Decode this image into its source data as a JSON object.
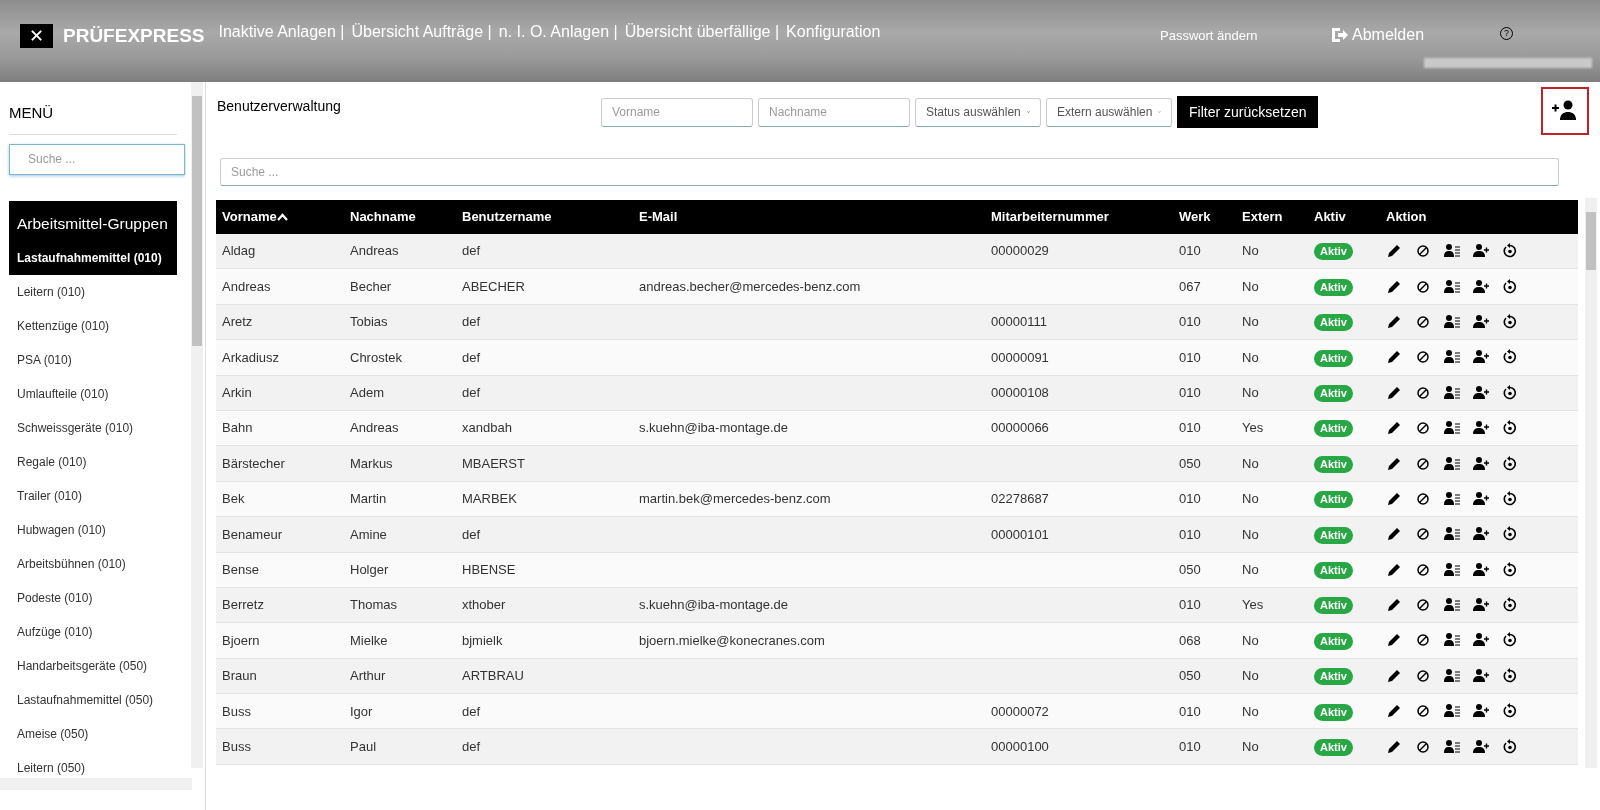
{
  "header": {
    "logo_mark": "✕",
    "brand": "PRÜFEXPRESS",
    "nav": [
      "Inaktive Anlagen |",
      "Übersicht Aufträge |",
      "n. I. O. Anlagen |",
      "Übersicht überfällige |",
      "Konfiguration"
    ],
    "password_link": "Passwort ändern",
    "logout": "Abmelden",
    "help": "?"
  },
  "sidebar": {
    "title": "MENÜ",
    "search": {
      "placeholder": "Suche ..."
    },
    "group_title": "Arbeitsmittel-Gruppen",
    "items": [
      {
        "label": "Lastaufnahmemittel (010)",
        "selected": true
      },
      {
        "label": "Leitern (010)",
        "selected": false
      },
      {
        "label": "Kettenzüge (010)",
        "selected": false
      },
      {
        "label": "PSA (010)",
        "selected": false
      },
      {
        "label": "Umlaufteile (010)",
        "selected": false
      },
      {
        "label": "Schweissgeräte (010)",
        "selected": false
      },
      {
        "label": "Regale (010)",
        "selected": false
      },
      {
        "label": "Trailer (010)",
        "selected": false
      },
      {
        "label": "Hubwagen (010)",
        "selected": false
      },
      {
        "label": "Arbeitsbühnen (010)",
        "selected": false
      },
      {
        "label": "Podeste (010)",
        "selected": false
      },
      {
        "label": "Aufzüge (010)",
        "selected": false
      },
      {
        "label": "Handarbeitsgeräte (050)",
        "selected": false
      },
      {
        "label": "Lastaufnahmemittel (050)",
        "selected": false
      },
      {
        "label": "Ameise (050)",
        "selected": false
      },
      {
        "label": "Leitern (050)",
        "selected": false
      }
    ]
  },
  "main": {
    "title": "Benutzerverwaltung",
    "filters": {
      "vorname": {
        "placeholder": "Vorname"
      },
      "nachname": {
        "placeholder": "Nachname"
      },
      "status": "Status auswählen",
      "extern": "Extern auswählen",
      "reset": "Filter zurücksetzen"
    },
    "search": {
      "placeholder": "Suche ..."
    }
  },
  "table": {
    "columns": [
      {
        "label": "Vorname",
        "sorted": true
      },
      {
        "label": "Nachname",
        "sorted": false
      },
      {
        "label": "Benutzername",
        "sorted": false
      },
      {
        "label": "E-Mail",
        "sorted": false
      },
      {
        "label": "Mitarbeiternummer",
        "sorted": false
      },
      {
        "label": "Werk",
        "sorted": false
      },
      {
        "label": "Extern",
        "sorted": false
      },
      {
        "label": "Aktiv",
        "sorted": false
      },
      {
        "label": "Aktion",
        "sorted": false
      }
    ],
    "rows": [
      {
        "cells": [
          "Aldag",
          "Andreas",
          "def",
          "",
          "00000029",
          "010",
          "No"
        ],
        "status": "Aktiv"
      },
      {
        "cells": [
          "Andreas",
          "Becher",
          "ABECHER",
          "andreas.becher@mercedes-benz.com",
          "",
          "067",
          "No"
        ],
        "status": "Aktiv"
      },
      {
        "cells": [
          "Aretz",
          "Tobias",
          "def",
          "",
          "00000111",
          "010",
          "No"
        ],
        "status": "Aktiv"
      },
      {
        "cells": [
          "Arkadiusz",
          "Chrostek",
          "def",
          "",
          "00000091",
          "010",
          "No"
        ],
        "status": "Aktiv"
      },
      {
        "cells": [
          "Arkin",
          "Adem",
          "def",
          "",
          "00000108",
          "010",
          "No"
        ],
        "status": "Aktiv"
      },
      {
        "cells": [
          "Bahn",
          "Andreas",
          "xandbah",
          "s.kuehn@iba-montage.de",
          "00000066",
          "010",
          "Yes"
        ],
        "status": "Aktiv"
      },
      {
        "cells": [
          "Bärstecher",
          "Markus",
          "MBAERST",
          "",
          "",
          "050",
          "No"
        ],
        "status": "Aktiv"
      },
      {
        "cells": [
          "Bek",
          "Martin",
          "MARBEK",
          "martin.bek@mercedes-benz.com",
          "02278687",
          "010",
          "No"
        ],
        "status": "Aktiv"
      },
      {
        "cells": [
          "Benameur",
          "Amine",
          "def",
          "",
          "00000101",
          "010",
          "No"
        ],
        "status": "Aktiv"
      },
      {
        "cells": [
          "Bense",
          "Holger",
          "HBENSE",
          "",
          "",
          "050",
          "No"
        ],
        "status": "Aktiv"
      },
      {
        "cells": [
          "Berretz",
          "Thomas",
          "xthober",
          "s.kuehn@iba-montage.de",
          "",
          "010",
          "Yes"
        ],
        "status": "Aktiv"
      },
      {
        "cells": [
          "Bjoern",
          "Mielke",
          "bjmielk",
          "bjoern.mielke@konecranes.com",
          "",
          "068",
          "No"
        ],
        "status": "Aktiv"
      },
      {
        "cells": [
          "Braun",
          "Arthur",
          "ARTBRAU",
          "",
          "",
          "050",
          "No"
        ],
        "status": "Aktiv"
      },
      {
        "cells": [
          "Buss",
          "Igor",
          "def",
          "",
          "00000072",
          "010",
          "No"
        ],
        "status": "Aktiv"
      },
      {
        "cells": [
          "Buss",
          "Paul",
          "def",
          "",
          "00000100",
          "010",
          "No"
        ],
        "status": "Aktiv"
      }
    ]
  }
}
